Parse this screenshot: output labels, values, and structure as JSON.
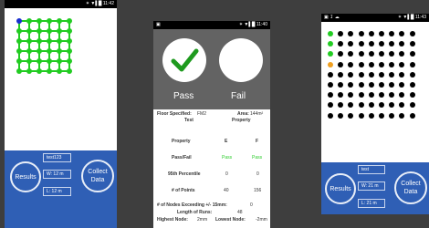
{
  "left_phone": {
    "status_time": "11:42",
    "status_icons": "✶ ▼▌█",
    "grid_rows": 6,
    "grid_cols": 6,
    "start_point": "blue",
    "buttons": {
      "results": "Results",
      "collect": "Collect Data"
    },
    "fields": {
      "name": "test123",
      "width": "W: 12 m",
      "length": "L: 12 m"
    }
  },
  "mid_phone": {
    "status_time": "11:40",
    "status_icons": "✶ ▼▌█",
    "pass_label": "Pass",
    "fail_label": "Fail",
    "floor_specified_label": "Floor Specified:",
    "floor_specified_value": "FM2",
    "area_label": "Area:",
    "area_value": "144m²",
    "test_header": "Test",
    "property_header": "Property",
    "col_e": "E",
    "col_f": "F",
    "rows": [
      {
        "label": "Property",
        "e": "E",
        "f": "F"
      },
      {
        "label": "Pass/Fail",
        "e": "Pass",
        "f": "Pass"
      },
      {
        "label": "95th Percentile",
        "e": "0",
        "f": "0"
      },
      {
        "label": "# of Points",
        "e": "40",
        "f": "156"
      }
    ],
    "exceeding_label": "# of Nodes Exceeding +/- 15mm:",
    "exceeding_value": "0",
    "runs_label": "Length of Runs:",
    "runs_value": "48",
    "highest_label": "Highest Node:",
    "highest_value": "2mm",
    "lowest_label": "Lowest Node:",
    "lowest_value": "-2mm"
  },
  "right_phone": {
    "status_time": "11:43",
    "status_icons": "✶ ▼▌█",
    "grid_rows": 9,
    "grid_cols": 9,
    "buttons": {
      "results": "Results",
      "collect": "Collect Data"
    },
    "fields": {
      "name": "test",
      "width": "W: 21 m",
      "length": "L: 21 m"
    }
  }
}
